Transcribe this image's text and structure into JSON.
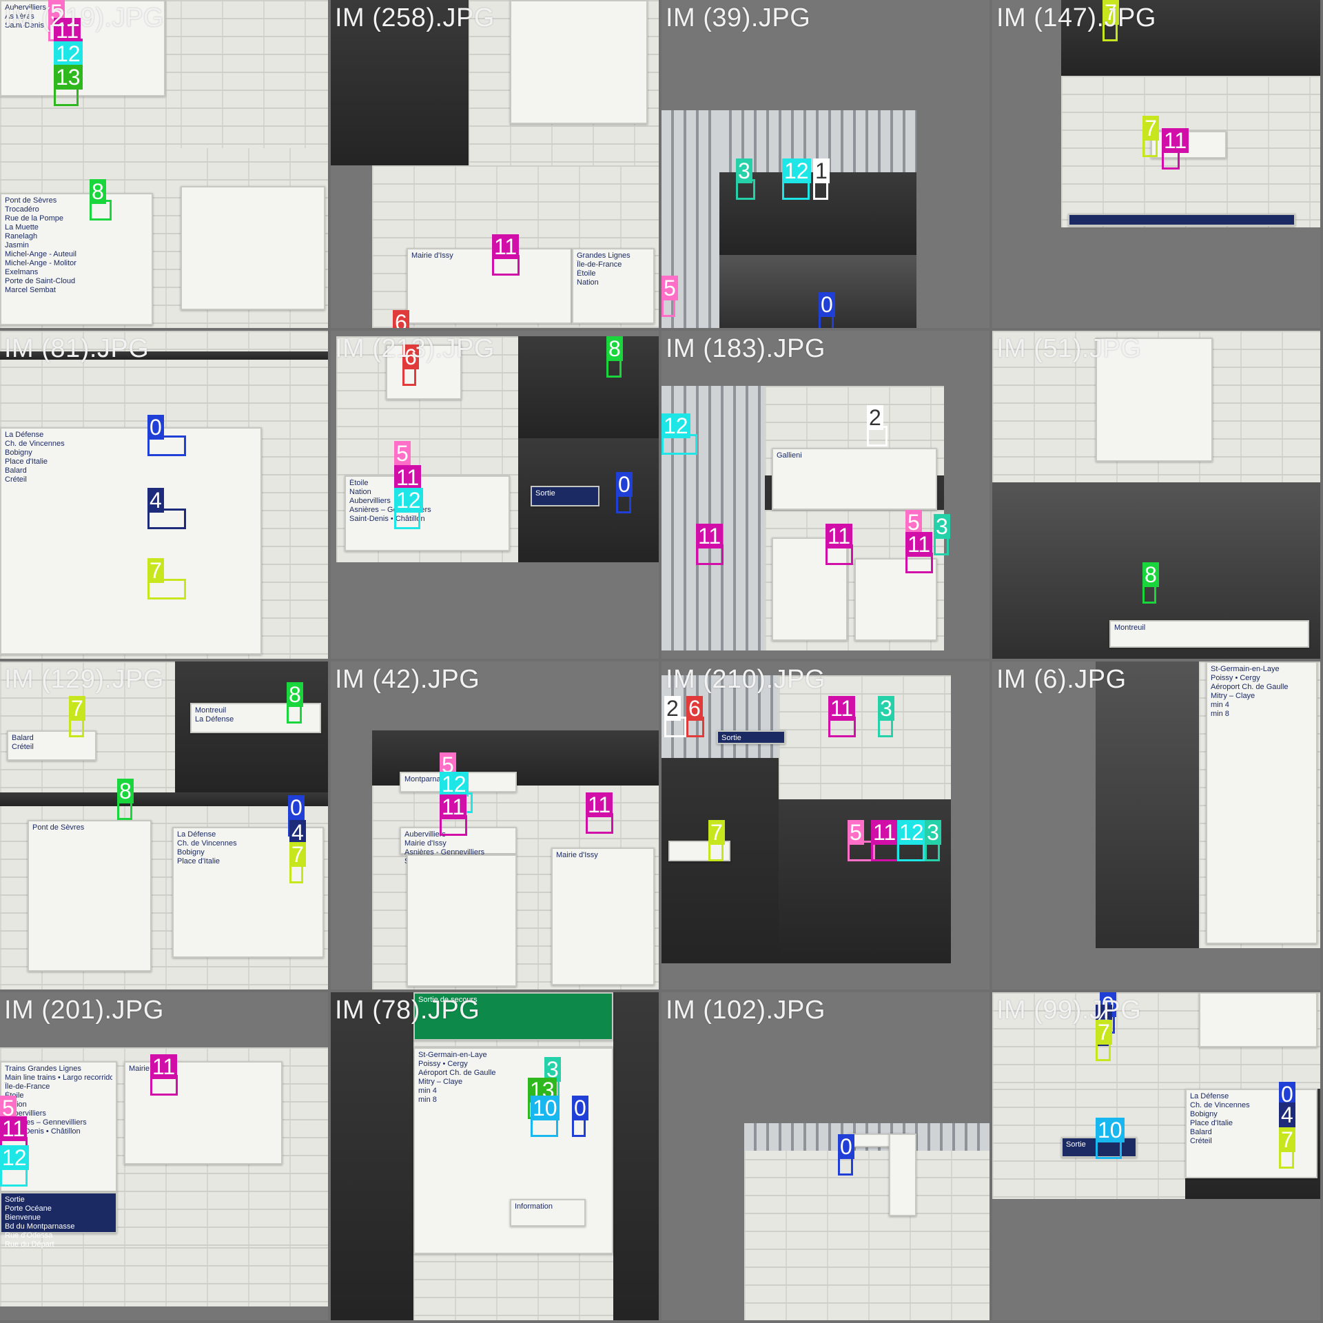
{
  "grid": {
    "columns": 4,
    "rows": 4,
    "background": "#6f6f6f"
  },
  "class_colors": {
    "0": "#1f3fd6",
    "2": "#ffffff",
    "3": "#24d1a8",
    "4": "#1d2b7a",
    "5": "#ff6ec7",
    "6": "#e03a3a",
    "7": "#c8e61e",
    "8": "#19d63c",
    "10": "#19b7f0",
    "11": "#d10fa8",
    "12": "#1ee6e6",
    "13": "#2fb81e"
  },
  "tiles": [
    {
      "title": "IM (219).JPG",
      "labels": [
        "5",
        "11",
        "12",
        "13",
        "8"
      ]
    },
    {
      "title": "IM (258).JPG",
      "labels": [
        "11",
        "6"
      ]
    },
    {
      "title": "IM (39).JPG",
      "labels": [
        "3",
        "12",
        "1",
        "5",
        "0"
      ]
    },
    {
      "title": "IM (147).JPG",
      "labels": [
        "7",
        "7",
        "11"
      ]
    },
    {
      "title": "IM (81).JPG",
      "labels": [
        "0",
        "4",
        "7"
      ]
    },
    {
      "title": "IM (213).JPG",
      "labels": [
        "6",
        "8",
        "5",
        "11",
        "12",
        "0"
      ]
    },
    {
      "title": "IM (183).JPG",
      "labels": [
        "2",
        "12",
        "11",
        "11",
        "5",
        "11",
        "3"
      ]
    },
    {
      "title": "IM (51).JPG",
      "labels": [
        "8"
      ]
    },
    {
      "title": "IM (129).JPG",
      "labels": [
        "7",
        "8",
        "8",
        "0",
        "4",
        "7"
      ]
    },
    {
      "title": "IM (42).JPG",
      "labels": [
        "5",
        "12",
        "11",
        "11"
      ]
    },
    {
      "title": "IM (210).JPG",
      "labels": [
        "2",
        "6",
        "11",
        "3",
        "7",
        "5",
        "11",
        "12",
        "3"
      ]
    },
    {
      "title": "IM (6).JPG",
      "labels": []
    },
    {
      "title": "IM (201).JPG",
      "labels": [
        "11",
        "5",
        "11",
        "12"
      ]
    },
    {
      "title": "IM (78).JPG",
      "labels": [
        "3",
        "13",
        "10",
        "0"
      ]
    },
    {
      "title": "IM (102).JPG",
      "labels": [
        "0"
      ]
    },
    {
      "title": "IM (99).JPG",
      "labels": [
        "0",
        "4",
        "7",
        "0",
        "4",
        "7",
        "10"
      ]
    }
  ],
  "sign_text": {
    "t0": [
      "Aubervilliers",
      "Asnières",
      "Saint-Denis",
      "Pont de Sèvres",
      "Trocadéro",
      "Rue de la Pompe",
      "La Muette",
      "Ranelagh",
      "Jasmin",
      "Michel-Ange - Auteuil",
      "Michel-Ange - Molitor",
      "Exelmans",
      "Porte de Saint-Cloud",
      "Marcel Sembat"
    ],
    "t1": [
      "Mairie d'Issy",
      "Grandes Lignes",
      "Île-de-France",
      "Étoile",
      "Nation"
    ],
    "t4": [
      "La Défense",
      "Ch. de Vincennes",
      "Bobigny",
      "Place d'Italie",
      "Balard",
      "Créteil"
    ],
    "t5": [
      "Étoile",
      "Nation",
      "Aubervilliers",
      "Asnières – Gennevilliers",
      "Saint-Denis • Châtillon",
      "Sortie"
    ],
    "t6": [
      "Gallieni"
    ],
    "t7": [
      "Montreuil"
    ],
    "t8": [
      "Balard",
      "Créteil",
      "Pont de Sèvres",
      "Montreuil",
      "La Défense",
      "Ch. de Vincennes",
      "Bobigny",
      "Place d'Italie"
    ],
    "t9": [
      "Montparnasse",
      "Aubervilliers",
      "Mairie d'Issy",
      "Asnières - Gennevilliers",
      "Saint-Denis • Châtillon"
    ],
    "t10": [
      "Sortie"
    ],
    "t11": [
      "St-Germain-en-Laye",
      "Poissy • Cergy",
      "Aéroport Ch. de Gaulle",
      "Mitry – Claye",
      "min 4",
      "min 8"
    ],
    "t12": [
      "Mairie d'Issy",
      "Trains Grandes Lignes",
      "Main line trains • Largo recorrido",
      "Île-de-France",
      "Étoile",
      "Nation",
      "Aubervilliers",
      "Asnières – Gennevilliers",
      "Saint-Denis • Châtillon",
      "Sortie",
      "Porte Océane",
      "Bienvenue",
      "Bd du Montparnasse",
      "Rue d'Odessa",
      "Rue du Départ"
    ],
    "t13": [
      "Sortie de secours",
      "St-Germain-en-Laye",
      "Poissy • Cergy",
      "Aéroport Ch. de Gaulle",
      "Mitry – Claye",
      "min 4",
      "min 8",
      "Information"
    ],
    "t15": [
      "La Défense",
      "Ch. de Vincennes",
      "Bobigny",
      "Place d'Italie",
      "Balard",
      "Créteil",
      "Sortie"
    ]
  }
}
